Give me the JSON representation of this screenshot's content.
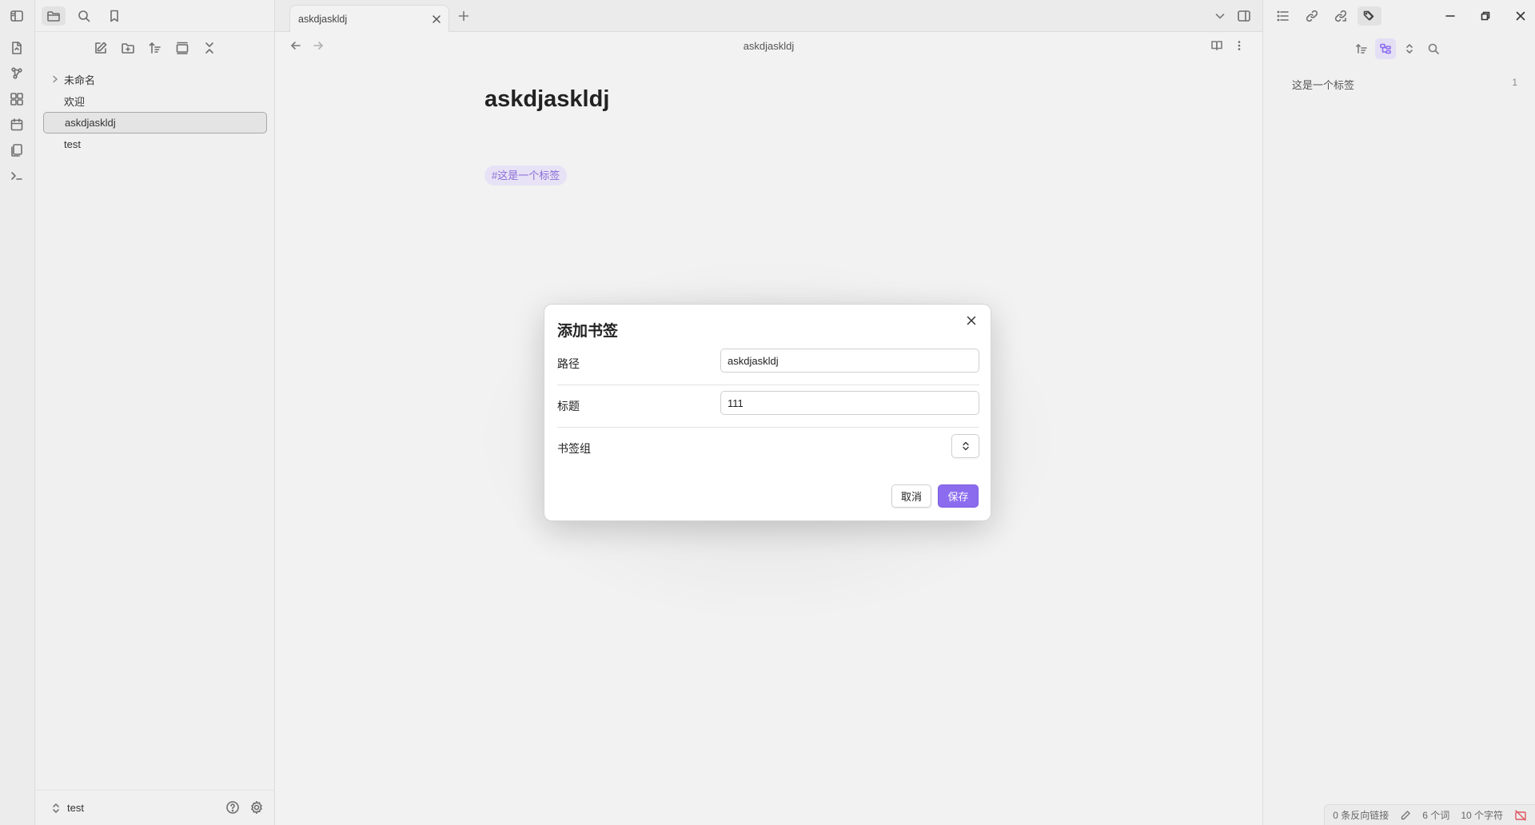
{
  "app": {
    "window_title": "askdjaskldj"
  },
  "left_sidebar": {
    "tree": [
      {
        "label": "未命名",
        "folder": true
      },
      {
        "label": "欢迎",
        "folder": false
      },
      {
        "label": "askdjaskldj",
        "folder": false,
        "active": true
      },
      {
        "label": "test",
        "folder": false
      }
    ],
    "vault_name": "test"
  },
  "tabs": [
    {
      "label": "askdjaskldj",
      "active": true
    }
  ],
  "view_header": {
    "title": "askdjaskldj"
  },
  "note": {
    "title": "askdjaskldj",
    "tag": "#这是一个标签"
  },
  "right_sidebar": {
    "tags": [
      {
        "name": "这是一个标签",
        "count": "1"
      }
    ]
  },
  "status_bar": {
    "backlinks": "0 条反向链接",
    "words": "6 个词",
    "chars": "10 个字符"
  },
  "modal": {
    "title": "添加书签",
    "path_label": "路径",
    "path_value": "askdjaskldj",
    "title_label": "标题",
    "title_value": "111",
    "group_label": "书签组",
    "cancel_label": "取消",
    "save_label": "保存"
  },
  "colors": {
    "accent": "#8b6cef",
    "tag_bg": "#e7e2f5",
    "tag_text": "#8a6cd8"
  }
}
